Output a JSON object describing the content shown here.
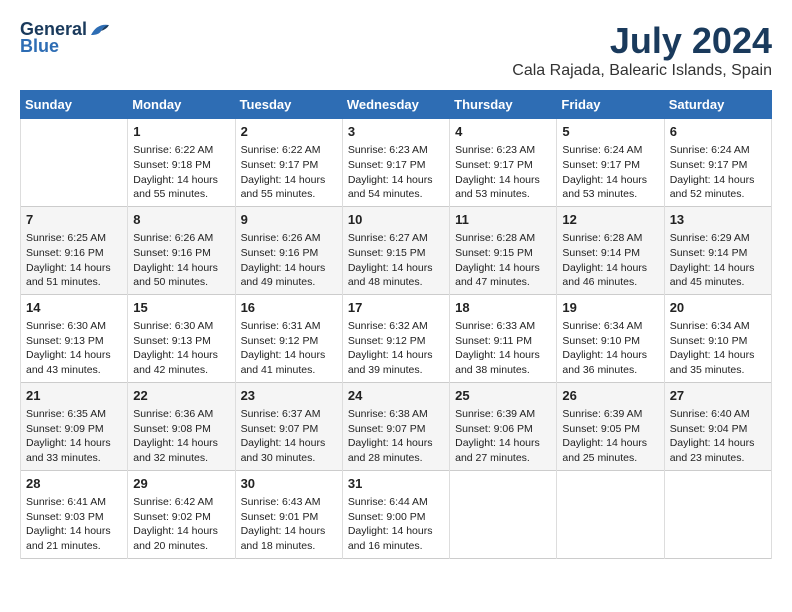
{
  "header": {
    "logo_line1": "General",
    "logo_line2": "Blue",
    "month": "July 2024",
    "location": "Cala Rajada, Balearic Islands, Spain"
  },
  "days_of_week": [
    "Sunday",
    "Monday",
    "Tuesday",
    "Wednesday",
    "Thursday",
    "Friday",
    "Saturday"
  ],
  "weeks": [
    [
      {
        "day": "",
        "info": ""
      },
      {
        "day": "1",
        "info": "Sunrise: 6:22 AM\nSunset: 9:18 PM\nDaylight: 14 hours\nand 55 minutes."
      },
      {
        "day": "2",
        "info": "Sunrise: 6:22 AM\nSunset: 9:17 PM\nDaylight: 14 hours\nand 55 minutes."
      },
      {
        "day": "3",
        "info": "Sunrise: 6:23 AM\nSunset: 9:17 PM\nDaylight: 14 hours\nand 54 minutes."
      },
      {
        "day": "4",
        "info": "Sunrise: 6:23 AM\nSunset: 9:17 PM\nDaylight: 14 hours\nand 53 minutes."
      },
      {
        "day": "5",
        "info": "Sunrise: 6:24 AM\nSunset: 9:17 PM\nDaylight: 14 hours\nand 53 minutes."
      },
      {
        "day": "6",
        "info": "Sunrise: 6:24 AM\nSunset: 9:17 PM\nDaylight: 14 hours\nand 52 minutes."
      }
    ],
    [
      {
        "day": "7",
        "info": "Sunrise: 6:25 AM\nSunset: 9:16 PM\nDaylight: 14 hours\nand 51 minutes."
      },
      {
        "day": "8",
        "info": "Sunrise: 6:26 AM\nSunset: 9:16 PM\nDaylight: 14 hours\nand 50 minutes."
      },
      {
        "day": "9",
        "info": "Sunrise: 6:26 AM\nSunset: 9:16 PM\nDaylight: 14 hours\nand 49 minutes."
      },
      {
        "day": "10",
        "info": "Sunrise: 6:27 AM\nSunset: 9:15 PM\nDaylight: 14 hours\nand 48 minutes."
      },
      {
        "day": "11",
        "info": "Sunrise: 6:28 AM\nSunset: 9:15 PM\nDaylight: 14 hours\nand 47 minutes."
      },
      {
        "day": "12",
        "info": "Sunrise: 6:28 AM\nSunset: 9:14 PM\nDaylight: 14 hours\nand 46 minutes."
      },
      {
        "day": "13",
        "info": "Sunrise: 6:29 AM\nSunset: 9:14 PM\nDaylight: 14 hours\nand 45 minutes."
      }
    ],
    [
      {
        "day": "14",
        "info": "Sunrise: 6:30 AM\nSunset: 9:13 PM\nDaylight: 14 hours\nand 43 minutes."
      },
      {
        "day": "15",
        "info": "Sunrise: 6:30 AM\nSunset: 9:13 PM\nDaylight: 14 hours\nand 42 minutes."
      },
      {
        "day": "16",
        "info": "Sunrise: 6:31 AM\nSunset: 9:12 PM\nDaylight: 14 hours\nand 41 minutes."
      },
      {
        "day": "17",
        "info": "Sunrise: 6:32 AM\nSunset: 9:12 PM\nDaylight: 14 hours\nand 39 minutes."
      },
      {
        "day": "18",
        "info": "Sunrise: 6:33 AM\nSunset: 9:11 PM\nDaylight: 14 hours\nand 38 minutes."
      },
      {
        "day": "19",
        "info": "Sunrise: 6:34 AM\nSunset: 9:10 PM\nDaylight: 14 hours\nand 36 minutes."
      },
      {
        "day": "20",
        "info": "Sunrise: 6:34 AM\nSunset: 9:10 PM\nDaylight: 14 hours\nand 35 minutes."
      }
    ],
    [
      {
        "day": "21",
        "info": "Sunrise: 6:35 AM\nSunset: 9:09 PM\nDaylight: 14 hours\nand 33 minutes."
      },
      {
        "day": "22",
        "info": "Sunrise: 6:36 AM\nSunset: 9:08 PM\nDaylight: 14 hours\nand 32 minutes."
      },
      {
        "day": "23",
        "info": "Sunrise: 6:37 AM\nSunset: 9:07 PM\nDaylight: 14 hours\nand 30 minutes."
      },
      {
        "day": "24",
        "info": "Sunrise: 6:38 AM\nSunset: 9:07 PM\nDaylight: 14 hours\nand 28 minutes."
      },
      {
        "day": "25",
        "info": "Sunrise: 6:39 AM\nSunset: 9:06 PM\nDaylight: 14 hours\nand 27 minutes."
      },
      {
        "day": "26",
        "info": "Sunrise: 6:39 AM\nSunset: 9:05 PM\nDaylight: 14 hours\nand 25 minutes."
      },
      {
        "day": "27",
        "info": "Sunrise: 6:40 AM\nSunset: 9:04 PM\nDaylight: 14 hours\nand 23 minutes."
      }
    ],
    [
      {
        "day": "28",
        "info": "Sunrise: 6:41 AM\nSunset: 9:03 PM\nDaylight: 14 hours\nand 21 minutes."
      },
      {
        "day": "29",
        "info": "Sunrise: 6:42 AM\nSunset: 9:02 PM\nDaylight: 14 hours\nand 20 minutes."
      },
      {
        "day": "30",
        "info": "Sunrise: 6:43 AM\nSunset: 9:01 PM\nDaylight: 14 hours\nand 18 minutes."
      },
      {
        "day": "31",
        "info": "Sunrise: 6:44 AM\nSunset: 9:00 PM\nDaylight: 14 hours\nand 16 minutes."
      },
      {
        "day": "",
        "info": ""
      },
      {
        "day": "",
        "info": ""
      },
      {
        "day": "",
        "info": ""
      }
    ]
  ]
}
